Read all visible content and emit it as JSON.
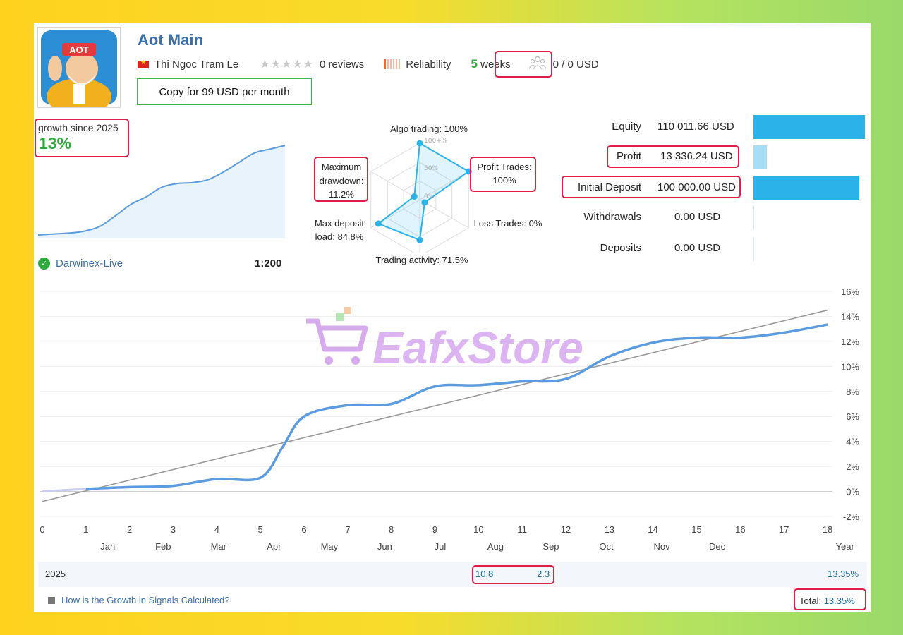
{
  "header": {
    "title": "Aot Main",
    "author": "Thi Ngoc Tram Le",
    "reviews": "0 reviews",
    "reliability": "Reliability",
    "weeks_num": "5",
    "weeks_label": " weeks",
    "subscribers": "0 / 0 USD",
    "copy_button": "Copy for 99 USD per month",
    "avatar_text": "AOT"
  },
  "growth": {
    "label": "growth since 2025",
    "value": "13%",
    "broker": "Darwinex-Live",
    "leverage": "1:200",
    "mini_chart": [
      0,
      0.05,
      0.1,
      0.2,
      0.45,
      1.0,
      1.6,
      2.0,
      2.5,
      2.7,
      2.75,
      2.9,
      3.3,
      3.8,
      4.3,
      4.5,
      4.7
    ]
  },
  "radar": {
    "algo": "Algo trading: 100%",
    "profit_trades": "Profit Trades:",
    "profit_trades_value": "100%",
    "loss_trades": "Loss Trades: 0%",
    "trading_activity": "Trading activity: 71.5%",
    "max_deposit": "Max deposit",
    "max_deposit_value": "load: 84.8%",
    "max_drawdown": "Maximum",
    "max_drawdown_2": "drawdown:",
    "max_drawdown_value": "11.2%",
    "scale_100": "100+%",
    "scale_50": "50%",
    "scale_0": "0%",
    "values": {
      "algo": 100,
      "profit": 100,
      "loss": 0,
      "activity": 71.5,
      "deposit": 84.8,
      "drawdown": 11.2
    }
  },
  "stats": [
    {
      "label": "Equity",
      "value": "110 011.66 USD",
      "fraction": 1.0
    },
    {
      "label": "Profit",
      "value": "13 336.24 USD",
      "fraction": 0.12
    },
    {
      "label": "Initial Deposit",
      "value": "100 000.00 USD",
      "fraction": 0.95
    },
    {
      "label": "Withdrawals",
      "value": "0.00 USD",
      "fraction": 0
    },
    {
      "label": "Deposits",
      "value": "0.00 USD",
      "fraction": 0
    }
  ],
  "colors": {
    "accent_blue": "#2bb3e8",
    "growth_line": "#5b9be0",
    "green": "#2eaa3b",
    "highlight": "#e11d48"
  },
  "watermark": "EafxStore",
  "chart_data": {
    "type": "line",
    "x": [
      0,
      1,
      2,
      3,
      4,
      5,
      6,
      7,
      8,
      9,
      10,
      11,
      12,
      13,
      14,
      15,
      16,
      17,
      18
    ],
    "x_ticks": [
      "0",
      "1",
      "2",
      "3",
      "4",
      "5",
      "6",
      "7",
      "8",
      "9",
      "10",
      "11",
      "12",
      "13",
      "14",
      "15",
      "16",
      "17",
      "18"
    ],
    "month_labels": [
      "Jan",
      "Feb",
      "Mar",
      "Apr",
      "May",
      "Jun",
      "Jul",
      "Aug",
      "Sep",
      "Oct",
      "Nov",
      "Dec",
      "Year"
    ],
    "y_ticks": [
      "16%",
      "14%",
      "12%",
      "10%",
      "8%",
      "6%",
      "4%",
      "2%",
      "0%",
      "-2%"
    ],
    "ylim": [
      -2,
      16
    ],
    "series": [
      {
        "x": [
          0,
          1,
          2,
          3,
          4,
          5,
          5.5,
          6,
          7,
          8,
          9,
          10,
          11,
          12,
          13,
          14,
          15,
          16,
          17,
          18
        ],
        "values": [
          0,
          0.2,
          0.35,
          0.45,
          1.0,
          1.1,
          3.5,
          6.0,
          6.9,
          7.0,
          8.4,
          8.5,
          8.8,
          9.0,
          10.8,
          11.9,
          12.3,
          12.3,
          12.7,
          13.35
        ]
      },
      {
        "x": [
          0,
          18
        ],
        "values": [
          -0.8,
          14.5
        ]
      }
    ]
  },
  "year_row": {
    "year": "2025",
    "jul": "10.8",
    "aug": "2.3",
    "total_year": "13.35%"
  },
  "footer": {
    "link": "How is the Growth in Signals Calculated?",
    "total_label": "Total: ",
    "total_value": "13.35%"
  }
}
